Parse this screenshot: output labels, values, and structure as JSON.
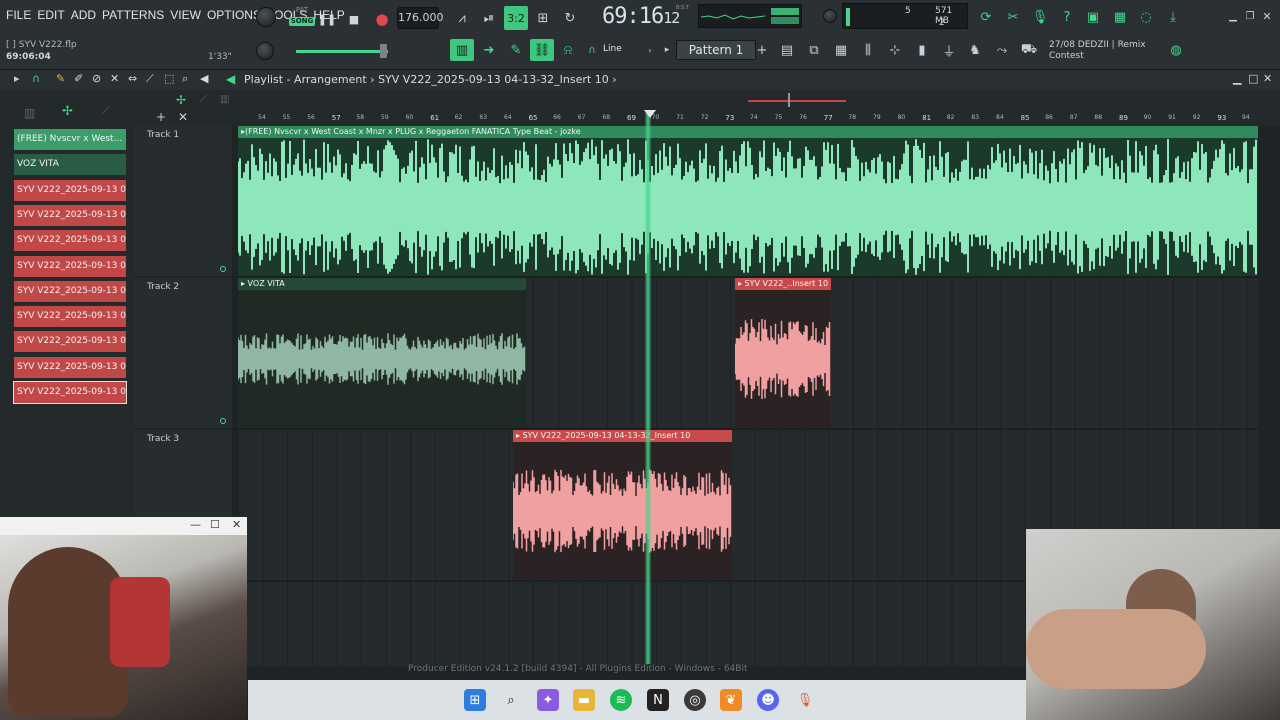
{
  "menu": [
    "FILE",
    "EDIT",
    "ADD",
    "PATTERNS",
    "VIEW",
    "OPTIONS",
    "TOOLS",
    "HELP"
  ],
  "file": {
    "name": "SYV V222.flp",
    "bracket": "[ ]",
    "time": "69:06:04",
    "hint_time": "1'33\""
  },
  "transport": {
    "pat_label": "PAT",
    "song_label": "SONG",
    "tempo": "176.000",
    "time_main": "69:16",
    "time_sub": "12",
    "bst_label": "B:S:T"
  },
  "cpu": {
    "v1": "5",
    "v2": "571 MB",
    "v3": "2"
  },
  "snap": {
    "label": "Line"
  },
  "pattern": {
    "label": "Pattern 1"
  },
  "news": {
    "line1": "27/08  DEDZII | Remix",
    "line2": "Contest"
  },
  "playlist": {
    "title": "Playlist - Arrangement",
    "breadcrumb": "SYV V222_2025-09-13 04-13-32_Insert 10"
  },
  "ruler_numbers": [
    "54",
    "55",
    "56",
    "57",
    "58",
    "59",
    "60",
    "61",
    "62",
    "63",
    "64",
    "65",
    "66",
    "67",
    "68",
    "69",
    "70",
    "71",
    "72",
    "73",
    "74",
    "75",
    "76",
    "77",
    "78",
    "79",
    "80",
    "81",
    "82",
    "83",
    "84",
    "85",
    "86",
    "87",
    "88",
    "89",
    "90",
    "91",
    "92",
    "93",
    "94"
  ],
  "picker": [
    {
      "label": "(FREE) Nvscvr x West...",
      "style": "audio"
    },
    {
      "label": "VOZ VITA",
      "style": "audio2"
    },
    {
      "label": "SYV V222_2025-09-13 04...",
      "style": "red"
    },
    {
      "label": "SYV V222_2025-09-13 04...",
      "style": "red"
    },
    {
      "label": "SYV V222_2025-09-13 04...",
      "style": "red"
    },
    {
      "label": "SYV V222_2025-09-13 04...",
      "style": "red"
    },
    {
      "label": "SYV V222_2025-09-13 04...",
      "style": "red"
    },
    {
      "label": "SYV V222_2025-09-13 04...",
      "style": "red"
    },
    {
      "label": "SYV V222_2025-09-13 04...",
      "style": "red"
    },
    {
      "label": "SYV V222_2025-09-13 04...",
      "style": "red"
    },
    {
      "label": "SYV V222_2025-09-13 04...",
      "style": "red-sel"
    }
  ],
  "tracks": [
    "Track 1",
    "Track 2",
    "Track 3"
  ],
  "clips": {
    "beat": "▸(FREE) Nvscvr x  West Coast  x Mnzr x PLUG  x Reggaeton FANATICA Type Beat - jozke",
    "voz": "▸ VOZ VITA",
    "insert_short": "▸ SYV V222_..Insert 10",
    "insert_full": "▸ SYV V222_2025-09-13 04-13-32_Insert 10"
  },
  "colors": {
    "accent": "#45d58b",
    "audio_clip": "#8ee6bb",
    "vocal_clip": "#f0a0a0",
    "vocal_head": "#c84a4a",
    "bg": "#1e2326"
  },
  "watermark": "Producer Edition v24.1.2 [build 4394] - All Plugins Edition - Windows - 64Bit"
}
